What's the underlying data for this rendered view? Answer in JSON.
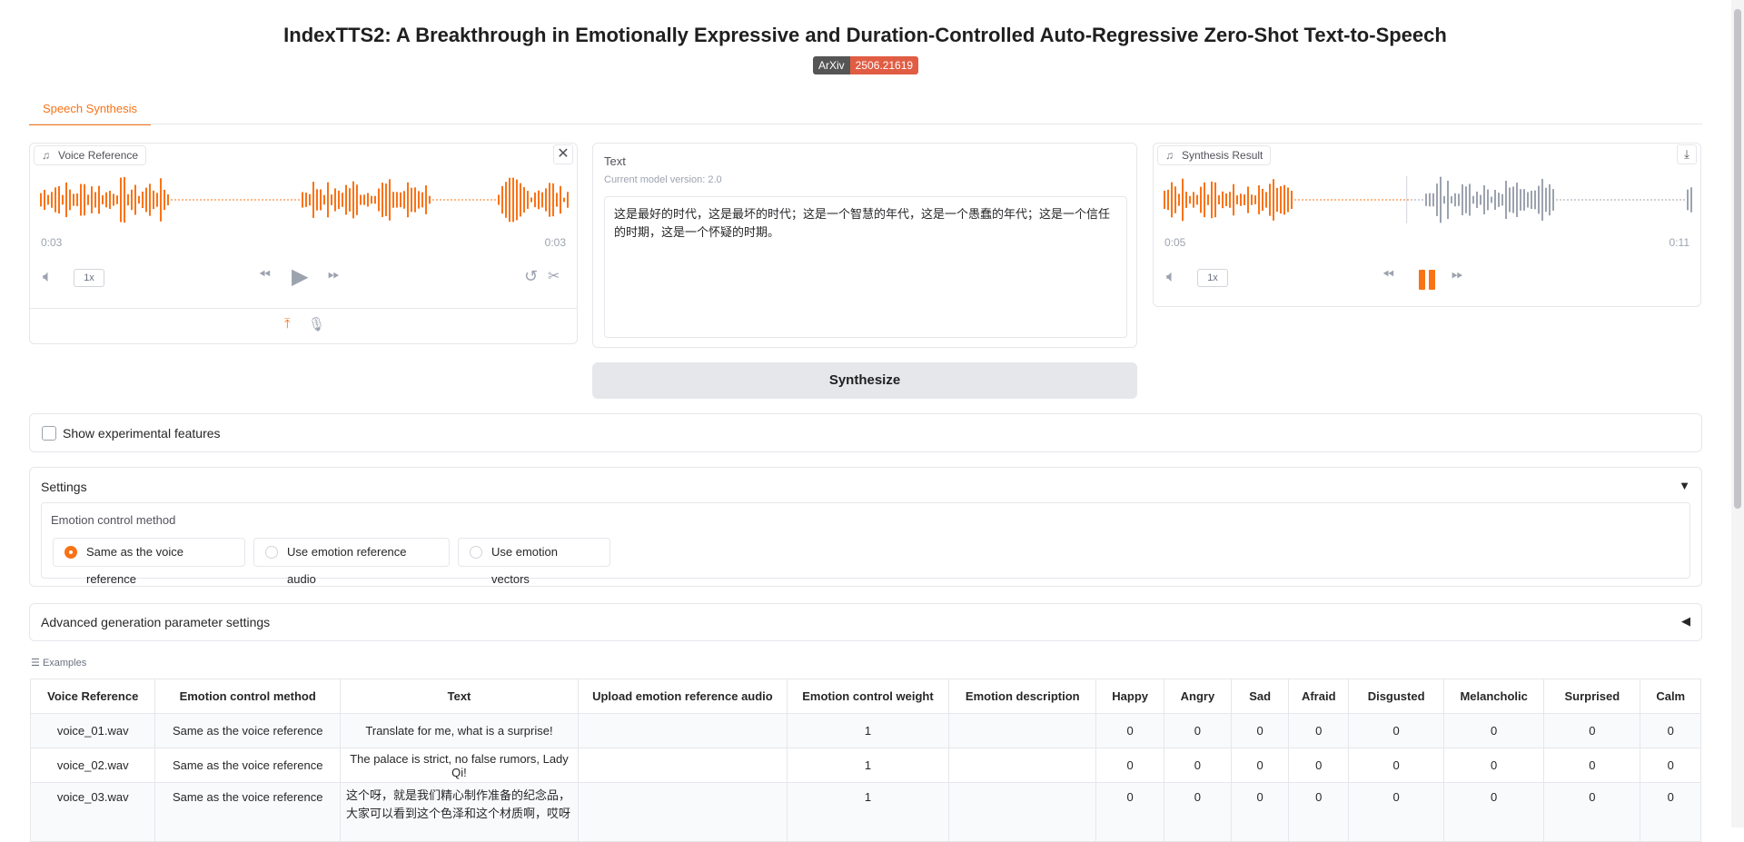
{
  "header": {
    "title": "IndexTTS2: A Breakthrough in Emotionally Expressive and Duration-Controlled Auto-Regressive Zero-Shot Text-to-Speech",
    "badge_left": "ArXiv",
    "badge_right": "2506.21619"
  },
  "tabs": [
    {
      "label": "Speech Synthesis",
      "active": true
    }
  ],
  "voice_reference": {
    "label": "Voice Reference",
    "time_current": "0:03",
    "time_total": "0:03",
    "rate": "1x"
  },
  "text_panel": {
    "label": "Text",
    "version": "Current model version: 2.0",
    "value": "这是最好的时代，这是最坏的时代；这是一个智慧的年代，这是一个愚蠢的年代；这是一个信任的时期，这是一个怀疑的时期。"
  },
  "synthesis_result": {
    "label": "Synthesis Result",
    "time_current": "0:05",
    "time_total": "0:11",
    "rate": "1x",
    "progress": 0.46
  },
  "synthesize_button": "Synthesize",
  "experimental": {
    "label": "Show experimental features",
    "checked": false
  },
  "settings": {
    "label": "Settings",
    "emotion_label": "Emotion control method",
    "options": [
      {
        "label": "Same as the voice reference",
        "selected": true
      },
      {
        "label": "Use emotion reference audio",
        "selected": false
      },
      {
        "label": "Use emotion vectors",
        "selected": false
      }
    ]
  },
  "advanced": {
    "label": "Advanced generation parameter settings"
  },
  "examples": {
    "label": "Examples",
    "columns": [
      "Voice Reference",
      "Emotion control method",
      "Text",
      "Upload emotion reference audio",
      "Emotion control weight",
      "Emotion description",
      "Happy",
      "Angry",
      "Sad",
      "Afraid",
      "Disgusted",
      "Melancholic",
      "Surprised",
      "Calm"
    ],
    "rows": [
      [
        "voice_01.wav",
        "Same as the voice reference",
        "Translate for me, what is a surprise!",
        "",
        "1",
        "",
        "0",
        "0",
        "0",
        "0",
        "0",
        "0",
        "0",
        "0"
      ],
      [
        "voice_02.wav",
        "Same as the voice reference",
        "The palace is strict, no false rumors, Lady Qi!",
        "",
        "1",
        "",
        "0",
        "0",
        "0",
        "0",
        "0",
        "0",
        "0",
        "0"
      ],
      [
        "voice_03.wav",
        "Same as the voice reference",
        "这个呀，就是我们精心制作准备的纪念品，大家可以看到这个色泽和这个材质啊，哎呀",
        "",
        "1",
        "",
        "0",
        "0",
        "0",
        "0",
        "0",
        "0",
        "0",
        "0"
      ]
    ]
  },
  "colors": {
    "accent": "#f97316",
    "wave_played": "#f97316",
    "wave_unplayed": "#9ca3af"
  },
  "icons": [
    "music-note-icon",
    "close-icon",
    "volume-icon",
    "rewind-icon",
    "play-icon",
    "fast-forward-icon",
    "undo-icon",
    "scissors-icon",
    "upload-icon",
    "microphone-icon",
    "download-icon",
    "pause-icon",
    "list-icon",
    "triangle-down-icon",
    "triangle-left-icon"
  ]
}
